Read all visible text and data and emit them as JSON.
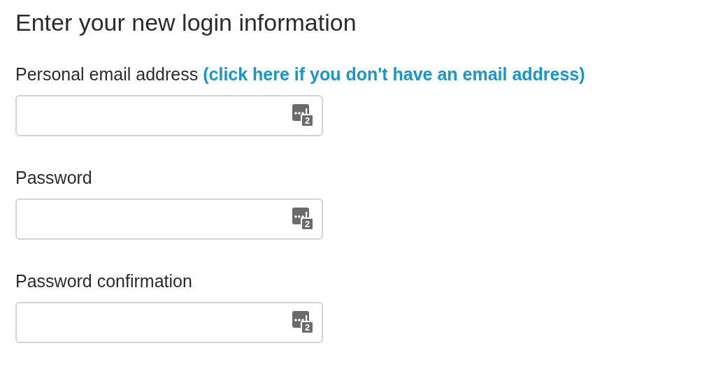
{
  "title": "Enter your new login information",
  "fields": [
    {
      "label": "Personal email address",
      "link": "(click here if you don't have an email address)",
      "badge": "2"
    },
    {
      "label": "Password",
      "badge": "2"
    },
    {
      "label": "Password confirmation",
      "badge": "2"
    }
  ]
}
